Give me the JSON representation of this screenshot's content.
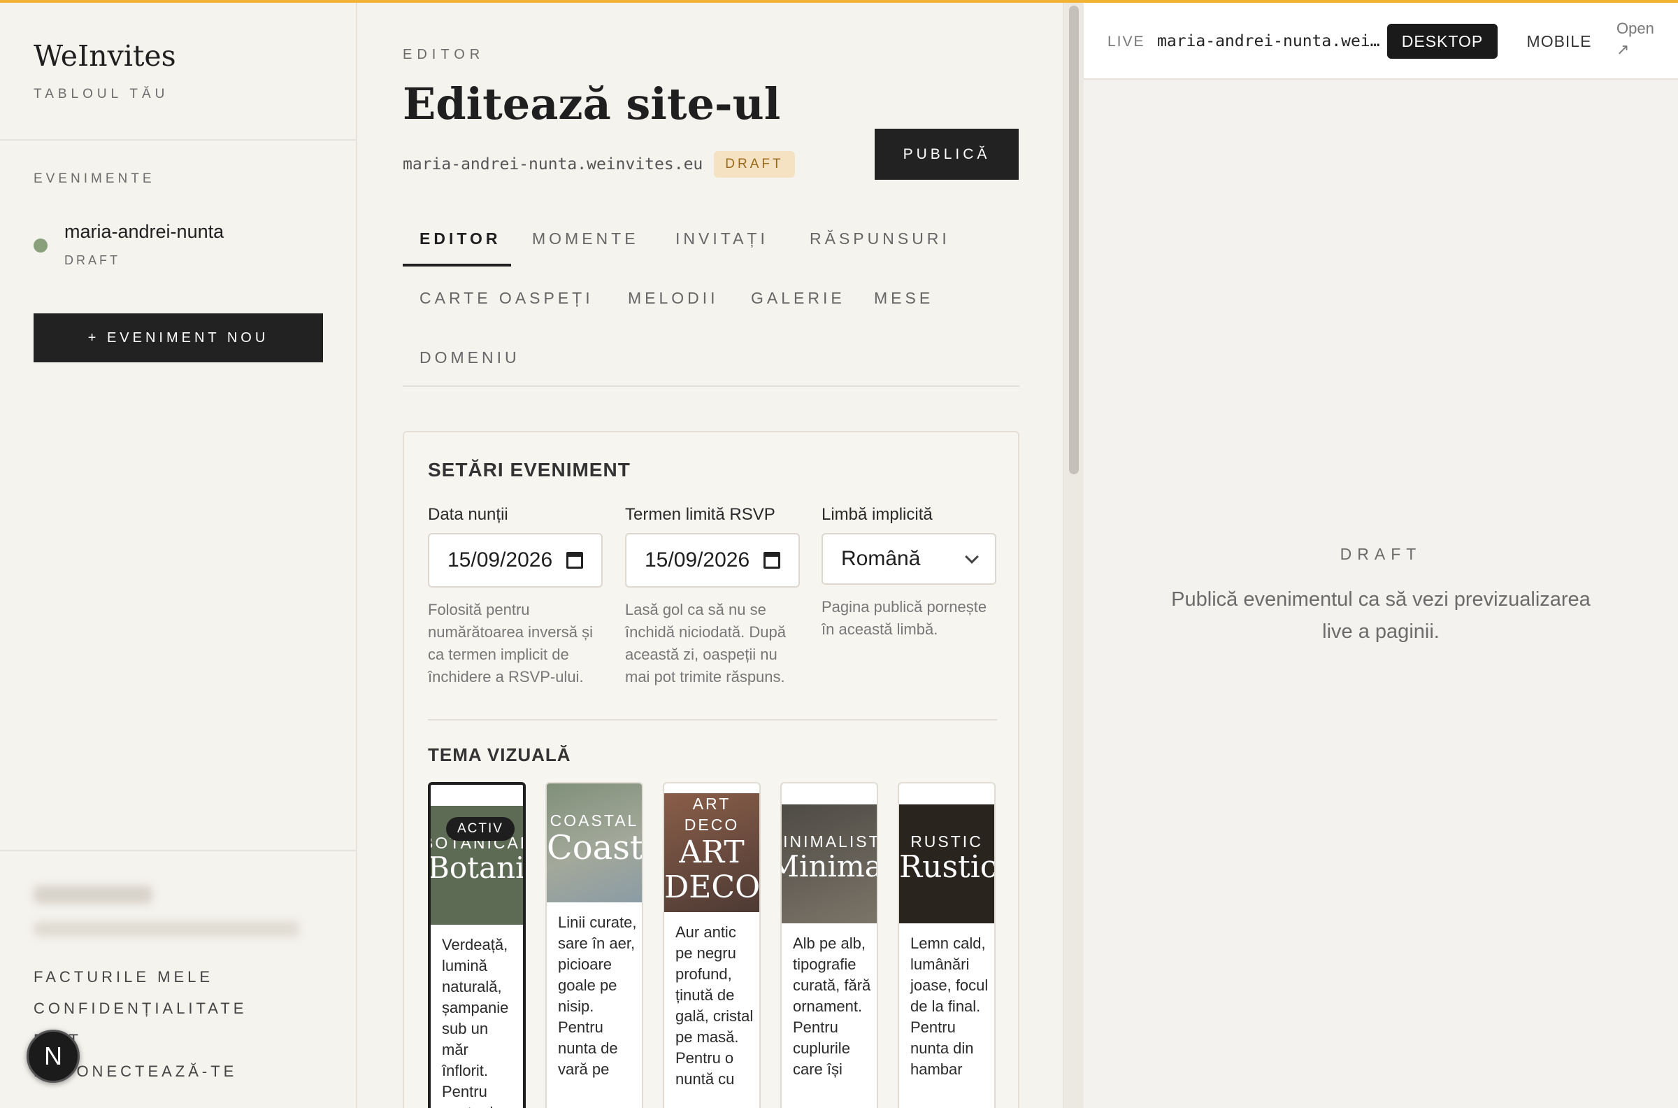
{
  "brand": {
    "name": "WeInvites",
    "subtitle": "TABLOUL TĂU"
  },
  "sidebar": {
    "section_label": "EVENIMENTE",
    "events": [
      {
        "name": "maria-andrei-nunta",
        "status": "DRAFT"
      }
    ],
    "new_event_label": "+ EVENIMENT NOU",
    "links": [
      "FACTURILE MELE",
      "CONFIDENȚIALITATE",
      "EXIT",
      "DECONECTEAZĂ-TE"
    ],
    "badge": "N"
  },
  "editor": {
    "eyebrow": "EDITOR",
    "title": "Editează site-ul",
    "domain": "maria-andrei-nunta.weinvites.eu",
    "status_badge": "DRAFT",
    "publish_label": "PUBLICĂ",
    "tabs": [
      "EDITOR",
      "MOMENTE",
      "INVITAȚI",
      "RĂSPUNSURI",
      "CARTE OASPEȚI",
      "MELODII",
      "GALERIE",
      "MESE",
      "DOMENIU"
    ],
    "active_tab": "EDITOR"
  },
  "settings": {
    "title": "SETĂRI EVENIMENT",
    "fields": [
      {
        "label": "Data nunții",
        "value": "15/09/2026",
        "help": "Folosită pentru numărătoarea inversă și ca termen implicit de închidere a RSVP-ului.",
        "icon": "calendar-icon"
      },
      {
        "label": "Termen limită RSVP",
        "value": "15/09/2026",
        "help": "Lasă gol ca să nu se închidă niciodată. După această zi, oaspeții nu mai pot trimite răspuns.",
        "icon": "calendar-icon"
      },
      {
        "label": "Limbă implicită",
        "value": "Română",
        "help": "Pagina publică pornește în această limbă.",
        "icon": "chevron-down-icon"
      }
    ],
    "theme_title": "TEMA VIZUALĂ",
    "active_badge": "ACTIV",
    "themes": [
      {
        "key": "botanical",
        "small": "BOTANICAL",
        "big": "Botanical",
        "desc": "Verdeață, lumină naturală, șampanie sub un măr înflorit. Pentru nunta de",
        "active": true,
        "bg": "#5d6b55"
      },
      {
        "key": "coastal",
        "small": "COASTAL",
        "big": "Coastal",
        "desc": "Linii curate, sare în aer, picioare goale pe nisip. Pentru nunta de vară pe",
        "active": false,
        "bg": "#8a9a8c"
      },
      {
        "key": "artdeco",
        "small": "ART DECO",
        "big": "ART DECO",
        "desc": "Aur antic pe negru profund, ținută de gală, cristal pe masă. Pentru o nuntă cu",
        "active": false,
        "bg": "#6e4a3d"
      },
      {
        "key": "minimalist",
        "small": "MINIMALIST",
        "big": "Minimalist",
        "desc": "Alb pe alb, tipografie curată, fără ornament. Pentru cuplurile care își",
        "active": false,
        "bg": "#5e5a52"
      },
      {
        "key": "rustic",
        "small": "RUSTIC",
        "big": "Rustic",
        "desc": "Lemn cald, lumânări joase, focul de la final. Pentru nunta din hambar",
        "active": false,
        "bg": "#2a241e"
      }
    ]
  },
  "preview": {
    "live_label": "LIVE",
    "url": "maria-andrei-nunta.wei…",
    "desktop_label": "DESKTOP",
    "mobile_label": "MOBILE",
    "open_label": "Open",
    "open_icon": "↗",
    "status": "DRAFT",
    "message": "Publică evenimentul ca să vezi previzualizarea live a paginii."
  },
  "colors": {
    "accent_bar": "#f2b233",
    "dark": "#222222",
    "event_dot": "#8aa07d",
    "draft_badge_bg": "#f4e2c2"
  }
}
